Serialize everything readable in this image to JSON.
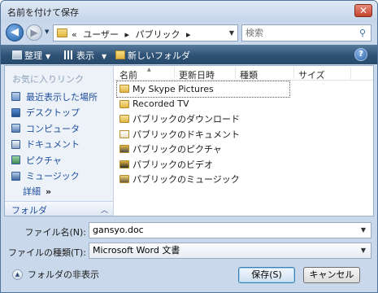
{
  "window": {
    "title": "名前を付けて保存",
    "close_label": "✕"
  },
  "address_bar": {
    "crumbs": [
      "«",
      "ユーザー",
      "▸",
      "パブリック",
      "▸"
    ],
    "search_placeholder": "検索"
  },
  "toolbar": {
    "organize": "整理",
    "views": "表示",
    "new_folder": "新しいフォルダ",
    "help": "?"
  },
  "nav_pane": {
    "favorites_title": "お気に入りリンク",
    "favorites": [
      {
        "label": "最近表示した場所",
        "icon": "recent-places-icon"
      },
      {
        "label": "デスクトップ",
        "icon": "desktop-icon"
      },
      {
        "label": "コンピュータ",
        "icon": "computer-icon"
      },
      {
        "label": "ドキュメント",
        "icon": "documents-icon"
      },
      {
        "label": "ピクチャ",
        "icon": "pictures-icon"
      },
      {
        "label": "ミュージック",
        "icon": "music-icon"
      }
    ],
    "more_label": "詳細",
    "more_arrows": "»",
    "folders_label": "フォルダ",
    "folders_chevron": "︿"
  },
  "file_list": {
    "columns": [
      "名前",
      "更新日時",
      "種類",
      "サイズ"
    ],
    "items": [
      {
        "name": "My Skype Pictures",
        "icon": "folder-icon"
      },
      {
        "name": "Recorded TV",
        "icon": "folder-icon"
      },
      {
        "name": "パブリックのダウンロード",
        "icon": "folder-icon"
      },
      {
        "name": "パブリックのドキュメント",
        "icon": "documents-folder-icon"
      },
      {
        "name": "パブリックのピクチャ",
        "icon": "pictures-folder-icon"
      },
      {
        "name": "パブリックのビデオ",
        "icon": "videos-folder-icon"
      },
      {
        "name": "パブリックのミュージック",
        "icon": "music-folder-icon"
      }
    ]
  },
  "form": {
    "filename_label": "ファイル名(N):",
    "filename_value": "gansyo.doc",
    "filetype_label": "ファイルの種類(T):",
    "filetype_value": "Microsoft Word 文書"
  },
  "footer": {
    "hide_folders": "フォルダの非表示",
    "save": "保存(S)",
    "cancel": "キャンセル"
  }
}
